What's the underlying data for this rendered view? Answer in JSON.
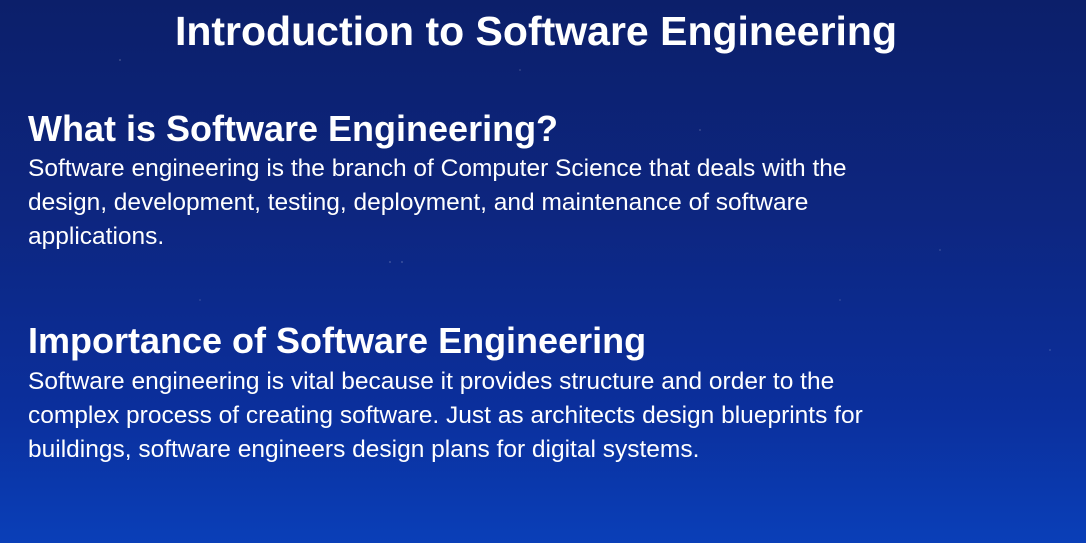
{
  "slide": {
    "title": "Introduction to Software Engineering",
    "sections": [
      {
        "heading": "What is Software Engineering?",
        "lines": [
          "Software engineering is the branch of Computer Science that deals with the",
          "design, development, testing, deployment, and maintenance of software",
          "applications."
        ]
      },
      {
        "heading": "Importance of Software Engineering",
        "lines": [
          "Software engineering is vital because it provides structure and order to the",
          "complex process of creating software. Just as architects design blueprints for",
          "buildings, software engineers design plans for digital systems."
        ]
      }
    ]
  }
}
